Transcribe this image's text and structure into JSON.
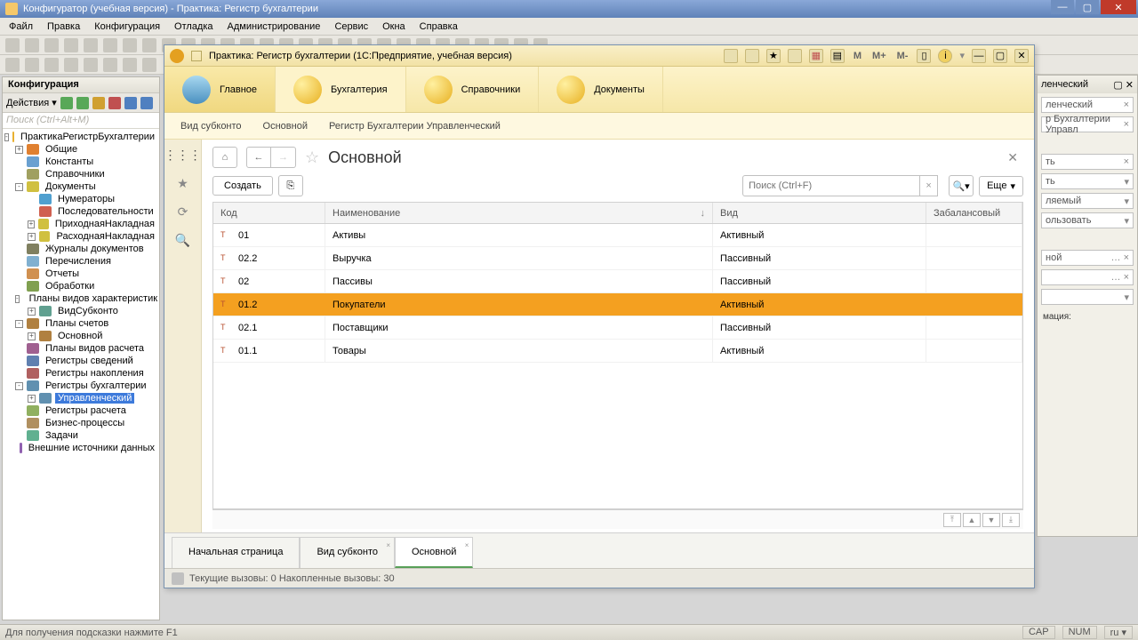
{
  "outerTitle": "Конфигуратор (учебная версия) - Практика: Регистр бухгалтерии",
  "menu": [
    "Файл",
    "Правка",
    "Конфигурация",
    "Отладка",
    "Администрирование",
    "Сервис",
    "Окна",
    "Справка"
  ],
  "configPanel": {
    "title": "Конфигурация",
    "actions": "Действия ▾",
    "searchPlaceholder": "Поиск (Ctrl+Alt+M)",
    "tree": [
      {
        "lvl": 0,
        "exp": "-",
        "icon": "#e8b030",
        "label": "ПрактикаРегистрБухгалтерии"
      },
      {
        "lvl": 1,
        "exp": "+",
        "icon": "#e08030",
        "label": "Общие"
      },
      {
        "lvl": 1,
        "exp": "",
        "icon": "#6aa0d0",
        "label": "Константы"
      },
      {
        "lvl": 1,
        "exp": "",
        "icon": "#a0a060",
        "label": "Справочники"
      },
      {
        "lvl": 1,
        "exp": "-",
        "icon": "#d0c040",
        "label": "Документы"
      },
      {
        "lvl": 2,
        "exp": "",
        "icon": "#50a0d0",
        "label": "Нумераторы"
      },
      {
        "lvl": 2,
        "exp": "",
        "icon": "#d06050",
        "label": "Последовательности"
      },
      {
        "lvl": 2,
        "exp": "+",
        "icon": "#d0c040",
        "label": "ПриходнаяНакладная"
      },
      {
        "lvl": 2,
        "exp": "+",
        "icon": "#d0c040",
        "label": "РасходнаяНакладная"
      },
      {
        "lvl": 1,
        "exp": "",
        "icon": "#808060",
        "label": "Журналы документов"
      },
      {
        "lvl": 1,
        "exp": "",
        "icon": "#80b0d0",
        "label": "Перечисления"
      },
      {
        "lvl": 1,
        "exp": "",
        "icon": "#d09050",
        "label": "Отчеты"
      },
      {
        "lvl": 1,
        "exp": "",
        "icon": "#80a050",
        "label": "Обработки"
      },
      {
        "lvl": 1,
        "exp": "-",
        "icon": "#60a090",
        "label": "Планы видов характеристик"
      },
      {
        "lvl": 2,
        "exp": "+",
        "icon": "#60a090",
        "label": "ВидСубконто"
      },
      {
        "lvl": 1,
        "exp": "-",
        "icon": "#b08040",
        "label": "Планы счетов"
      },
      {
        "lvl": 2,
        "exp": "+",
        "icon": "#b08040",
        "label": "Основной"
      },
      {
        "lvl": 1,
        "exp": "",
        "icon": "#a06090",
        "label": "Планы видов расчета"
      },
      {
        "lvl": 1,
        "exp": "",
        "icon": "#6080b0",
        "label": "Регистры сведений"
      },
      {
        "lvl": 1,
        "exp": "",
        "icon": "#b06060",
        "label": "Регистры накопления"
      },
      {
        "lvl": 1,
        "exp": "-",
        "icon": "#6090b0",
        "label": "Регистры бухгалтерии"
      },
      {
        "lvl": 2,
        "exp": "+",
        "icon": "#6090b0",
        "label": "Управленческий",
        "selected": true
      },
      {
        "lvl": 1,
        "exp": "",
        "icon": "#90b060",
        "label": "Регистры расчета"
      },
      {
        "lvl": 1,
        "exp": "",
        "icon": "#b09060",
        "label": "Бизнес-процессы"
      },
      {
        "lvl": 1,
        "exp": "",
        "icon": "#60b090",
        "label": "Задачи"
      },
      {
        "lvl": 1,
        "exp": "",
        "icon": "#9060b0",
        "label": "Внешние источники данных"
      }
    ]
  },
  "ent": {
    "title": "Практика: Регистр бухгалтерии  (1С:Предприятие, учебная версия)",
    "mbuttons": [
      "M",
      "M+",
      "M-"
    ],
    "nav": [
      {
        "label": "Главное",
        "type": "home",
        "cls": "first"
      },
      {
        "label": "Бухгалтерия",
        "type": "gold",
        "cls": "active"
      },
      {
        "label": "Справочники",
        "type": "gold",
        "cls": ""
      },
      {
        "label": "Документы",
        "type": "gold",
        "cls": ""
      }
    ],
    "crumbs": [
      "Вид субконто",
      "Основной",
      "Регистр Бухгалтерии Управленческий"
    ],
    "pageTitle": "Основной",
    "create": "Создать",
    "searchPlaceholder": "Поиск (Ctrl+F)",
    "more": "Еще",
    "columns": {
      "code": "Код",
      "name": "Наименование",
      "kind": "Вид",
      "bal": "Забалансовый"
    },
    "rows": [
      {
        "code": "01",
        "name": "Активы",
        "kind": "Активный",
        "sel": false
      },
      {
        "code": "02.2",
        "name": "Выручка",
        "kind": "Пассивный",
        "sel": false
      },
      {
        "code": "02",
        "name": "Пассивы",
        "kind": "Пассивный",
        "sel": false
      },
      {
        "code": "01.2",
        "name": "Покупатели",
        "kind": "Активный",
        "sel": true
      },
      {
        "code": "02.1",
        "name": "Поставщики",
        "kind": "Пассивный",
        "sel": false
      },
      {
        "code": "01.1",
        "name": "Товары",
        "kind": "Активный",
        "sel": false
      }
    ],
    "tabs": [
      {
        "label": "Начальная страница",
        "active": false,
        "close": false
      },
      {
        "label": "Вид субконто",
        "active": false,
        "close": true
      },
      {
        "label": "Основной",
        "active": true,
        "close": true
      }
    ],
    "status": "Текущие вызовы: 0   Накопленные вызовы: 30"
  },
  "rightPanel": {
    "title": "ленческий",
    "rows": [
      "ленческий",
      "р Бухгалтерии Управл",
      "ть",
      "ть",
      "ляемый",
      "ользовать",
      "ной",
      "",
      "",
      "мация:"
    ]
  },
  "status": {
    "hint": "Для получения подсказки нажмите F1",
    "cells": [
      "CAP",
      "NUM",
      "ru ▾"
    ]
  }
}
